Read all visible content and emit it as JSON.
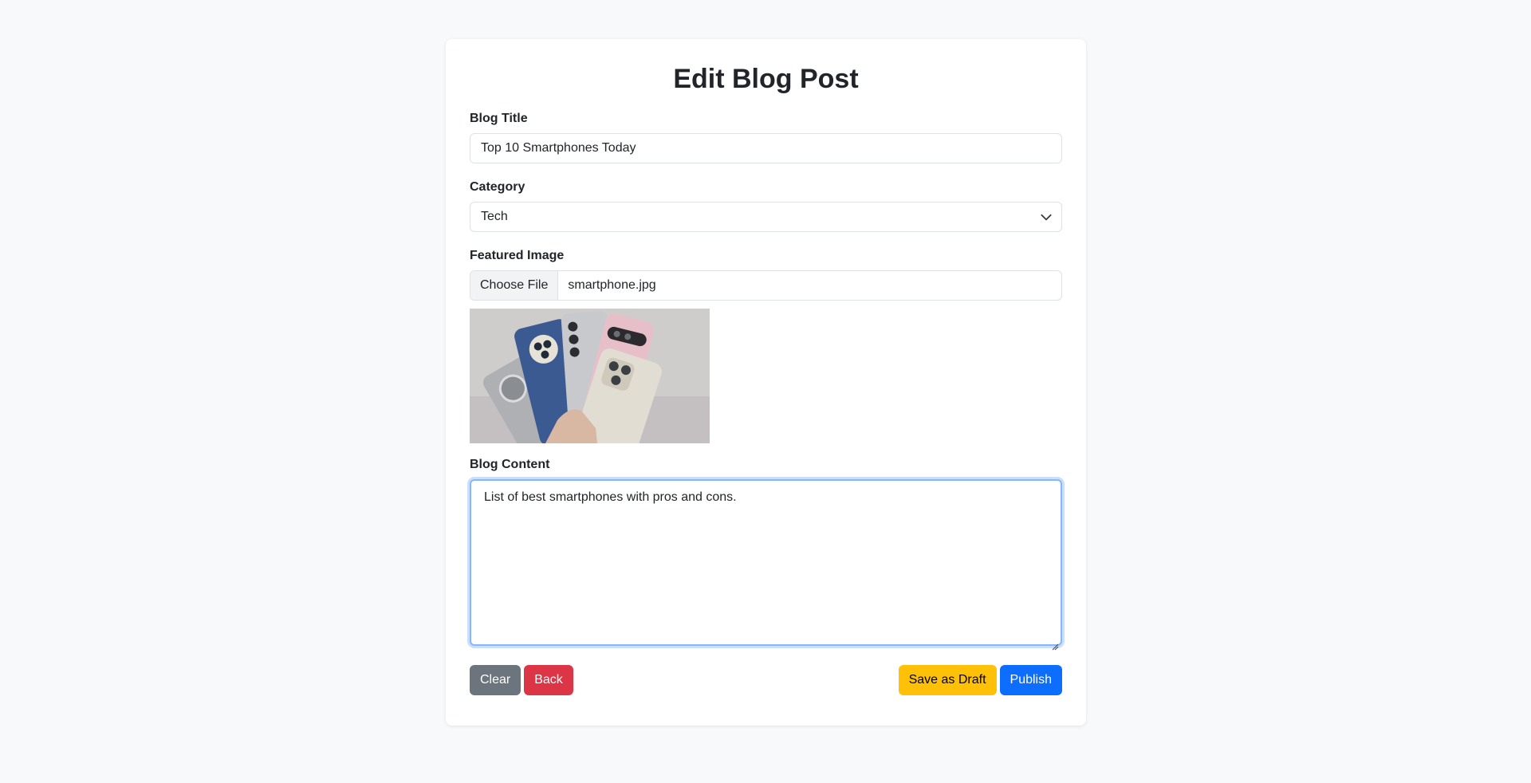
{
  "page": {
    "title": "Edit Blog Post"
  },
  "form": {
    "title_label": "Blog Title",
    "title_value": "Top 10 Smartphones Today",
    "category_label": "Category",
    "category_value": "Tech",
    "image_label": "Featured Image",
    "choose_file_label": "Choose File",
    "file_name": "smartphone.jpg",
    "content_label": "Blog Content",
    "content_value": "List of best smartphones with pros and cons."
  },
  "actions": {
    "clear_label": "Clear",
    "back_label": "Back",
    "draft_label": "Save as Draft",
    "publish_label": "Publish"
  },
  "colors": {
    "page_background": "#f8f9fa",
    "secondary": "#6c757d",
    "danger": "#dc3545",
    "warning": "#ffc107",
    "primary": "#0d6efd",
    "focus_border": "#86b7fe"
  },
  "icons": {
    "select_caret": "chevron-down-icon",
    "textarea_resize": "resize-handle-icon"
  }
}
